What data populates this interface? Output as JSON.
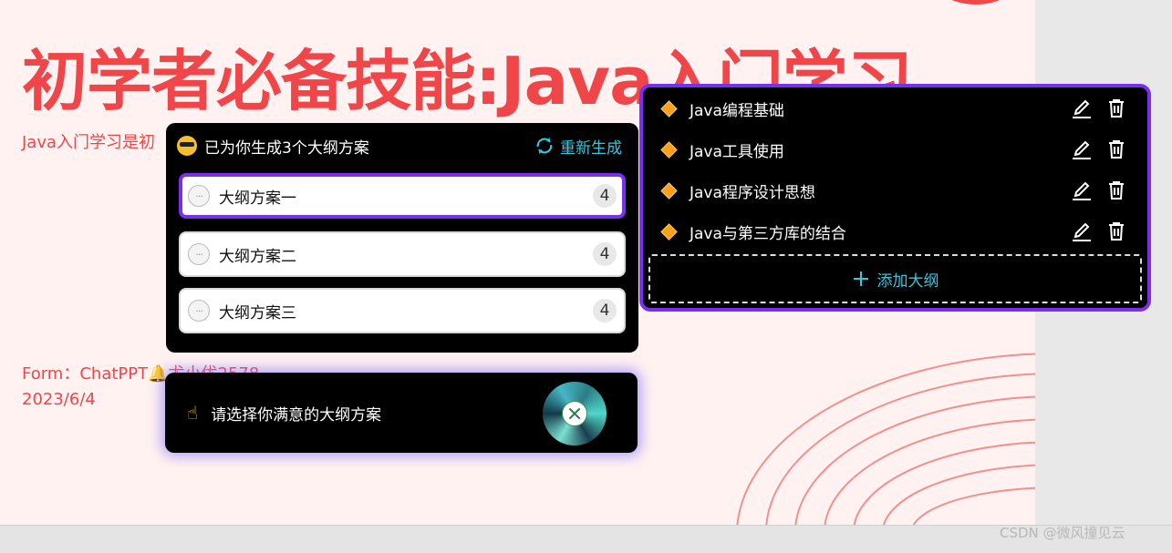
{
  "slide": {
    "title": "初学者必备技能:Java入门学习",
    "subtitle": "Java入门学习是初",
    "form_line": "Form：ChatPPT🔔尤小优2578",
    "date": "2023/6/4"
  },
  "plans_panel": {
    "header": "已为你生成3个大纲方案",
    "regenerate_label": "重新生成",
    "items": [
      {
        "label": "大纲方案一",
        "count": "4"
      },
      {
        "label": "大纲方案二",
        "count": "4"
      },
      {
        "label": "大纲方案三",
        "count": "4"
      }
    ],
    "selected_index": 0
  },
  "prompt": {
    "text": "请选择你满意的大纲方案",
    "hand_icon": "pointing-hand-icon"
  },
  "outline_panel": {
    "items": [
      {
        "label": "Java编程基础"
      },
      {
        "label": "Java工具使用"
      },
      {
        "label": "Java程序设计思想"
      },
      {
        "label": "Java与第三方库的结合"
      }
    ],
    "add_label": "添加大纲"
  },
  "watermark": "CSDN @微风撞见云",
  "colors": {
    "accent_purple": "#7a2ff0",
    "accent_cyan": "#33c8e0",
    "slide_red": "#f0464a",
    "diamond_orange": "#f7a21b"
  }
}
